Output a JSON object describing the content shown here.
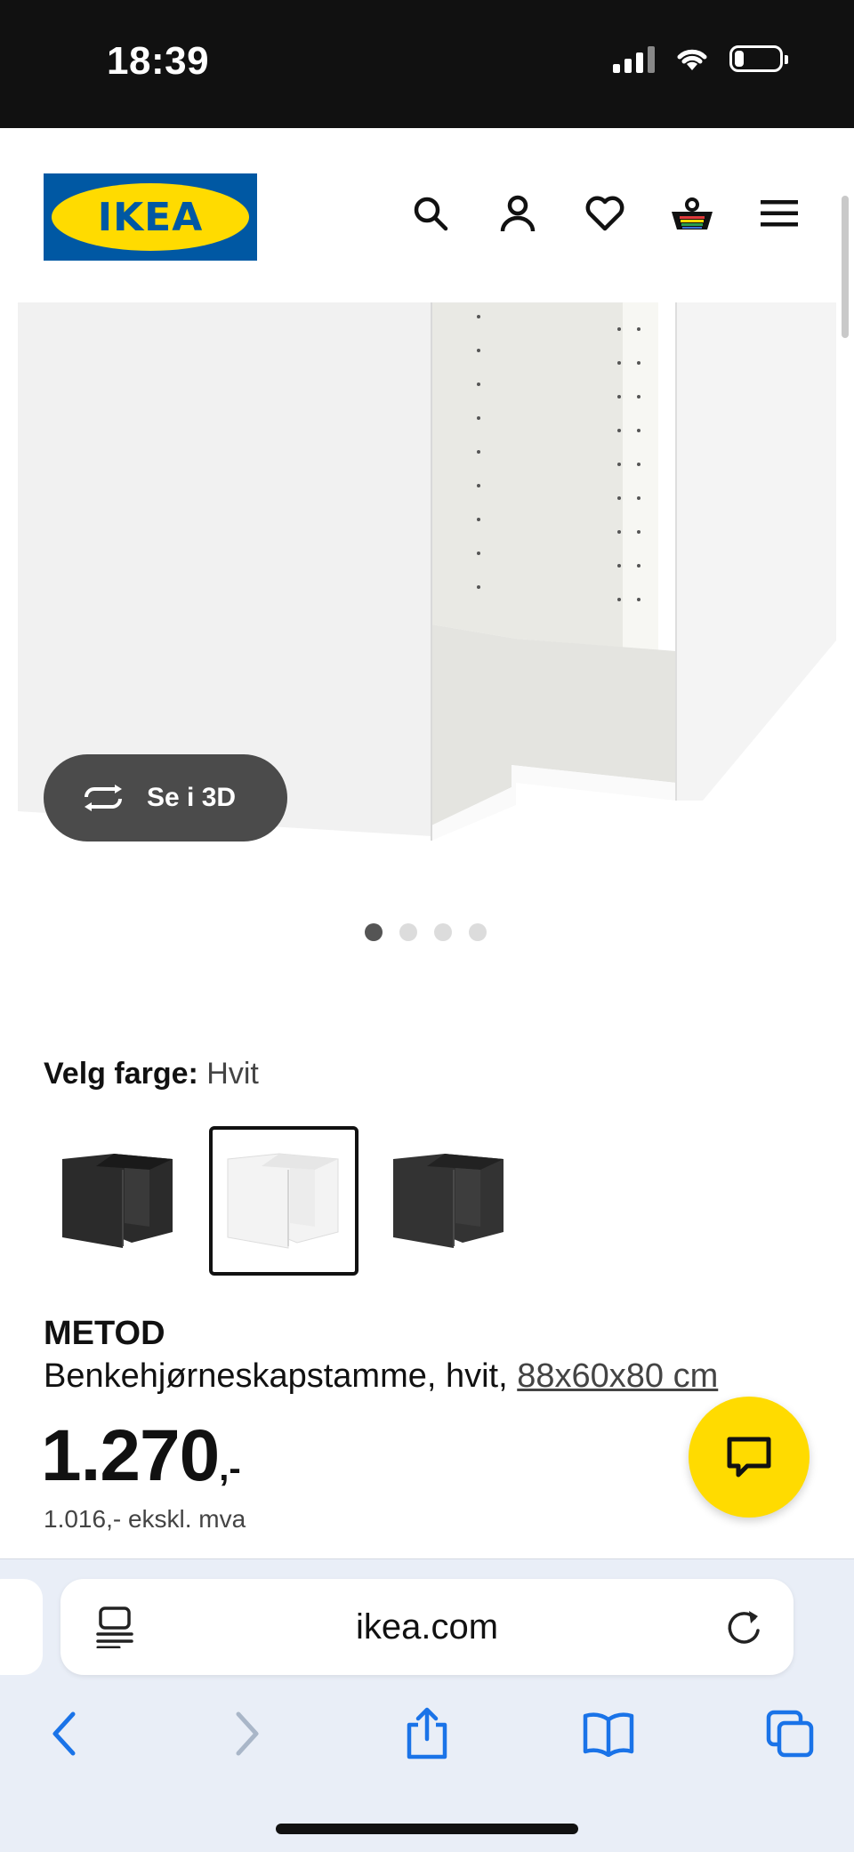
{
  "status_bar": {
    "time": "18:39"
  },
  "header": {
    "logo_text": "IKEA",
    "icons": [
      "search-icon",
      "account-icon",
      "heart-icon",
      "cart-icon",
      "menu-icon"
    ]
  },
  "gallery": {
    "view_3d_label": "Se i 3D",
    "image_count": 4,
    "active_index": 0
  },
  "color_picker": {
    "label": "Velg farge:",
    "selected": "Hvit",
    "options": [
      "black-brown",
      "white",
      "black"
    ]
  },
  "product": {
    "name": "METOD",
    "description": "Benkehjørneskapstamme, hvit, ",
    "dimensions": "88x60x80 cm",
    "price": "1.270",
    "price_suffix": ",-",
    "price_excl": "1.016,- ekskl. mva"
  },
  "browser": {
    "url": "ikea.com"
  },
  "colors": {
    "ikea_blue": "#0058a3",
    "ikea_yellow": "#ffdb00",
    "safari_blue": "#1a73e8"
  }
}
